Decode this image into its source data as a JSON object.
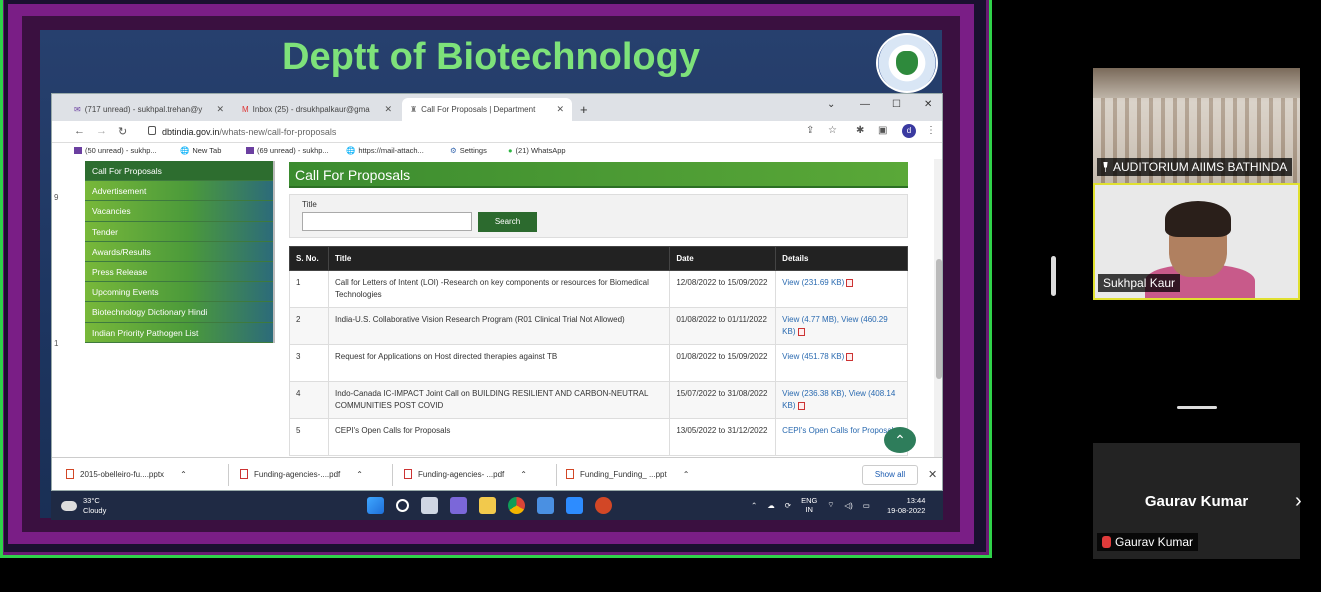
{
  "slide": {
    "title": "Deptt of Biotechnology"
  },
  "browser": {
    "tabs": [
      {
        "label": "(717 unread) - sukhpal.trehan@y"
      },
      {
        "label": "Inbox (25) - drsukhpalkaur@gma"
      },
      {
        "label": "Call For Proposals | Department"
      }
    ],
    "url": "dbtindia.gov.in",
    "url_path": "/whats-new/call-for-proposals",
    "bookmarks": [
      {
        "label": "(50 unread) - sukhp..."
      },
      {
        "label": "New Tab"
      },
      {
        "label": "(69 unread) - sukhp..."
      },
      {
        "label": "https://mail-attach..."
      },
      {
        "label": "Settings"
      },
      {
        "label": "(21) WhatsApp"
      }
    ],
    "profile_initial": "d"
  },
  "sidemenu": {
    "items": [
      {
        "label": "Call For Proposals"
      },
      {
        "label": "Advertisement"
      },
      {
        "label": "Vacancies"
      },
      {
        "label": "Tender"
      },
      {
        "label": "Awards/Results"
      },
      {
        "label": "Press Release"
      },
      {
        "label": "Upcoming Events"
      },
      {
        "label": "Biotechnology Dictionary Hindi"
      },
      {
        "label": "Indian Priority Pathogen List"
      }
    ]
  },
  "content": {
    "heading": "Call For Proposals",
    "search_label": "Title",
    "search_button": "Search",
    "table_headers": [
      "S. No.",
      "Title",
      "Date",
      "Details"
    ],
    "rows": [
      {
        "sno": "1",
        "title": "Call for Letters of Intent (LOI) -Research on key components or resources for Biomedical Technologies",
        "date": "12/08/2022 to 15/09/2022",
        "details": "View (231.69 KB)"
      },
      {
        "sno": "2",
        "title": "India-U.S. Collaborative Vision Research Program (R01 Clinical Trial Not Allowed)",
        "date": "01/08/2022 to 01/11/2022",
        "details": "View (4.77 MB), View (460.29 KB)"
      },
      {
        "sno": "3",
        "title": "Request for Applications on Host directed therapies against TB",
        "date": "01/08/2022 to 15/09/2022",
        "details": "View (451.78 KB)"
      },
      {
        "sno": "4",
        "title": "Indo-Canada IC-IMPACT Joint Call on BUILDING RESILIENT AND CARBON-NEUTRAL COMMUNITIES POST COVID",
        "date": "15/07/2022 to 31/08/2022",
        "details": "View (236.38 KB), View (408.14 KB)"
      },
      {
        "sno": "5",
        "title": "CEPI's Open Calls for Proposals",
        "date": "13/05/2022 to 31/12/2022",
        "details": "CEPI's Open Calls for Proposals"
      }
    ]
  },
  "downloads": {
    "items": [
      {
        "label": "2015-obelleiro-fu....pptx"
      },
      {
        "label": "Funding-agencies-....pdf"
      },
      {
        "label": "Funding-agencies- ...pdf"
      },
      {
        "label": "Funding_Funding_ ...ppt"
      }
    ],
    "show_all": "Show all"
  },
  "taskbar": {
    "temp": "33°C",
    "weather": "Cloudy",
    "lang": "ENG",
    "region": "IN",
    "time": "13:44",
    "date": "19-08-2022"
  },
  "participants": {
    "room_name": "AUDITORIUM AIIMS BATHINDA",
    "speaker_name": "Sukhpal Kaur",
    "third_name_large": "Gaurav Kumar",
    "third_name_tag": "Gaurav Kumar"
  },
  "colors": {
    "slide_title": "#7ee27a",
    "menu_active": "#2d6d2f",
    "share_border": "#2fd24a"
  }
}
